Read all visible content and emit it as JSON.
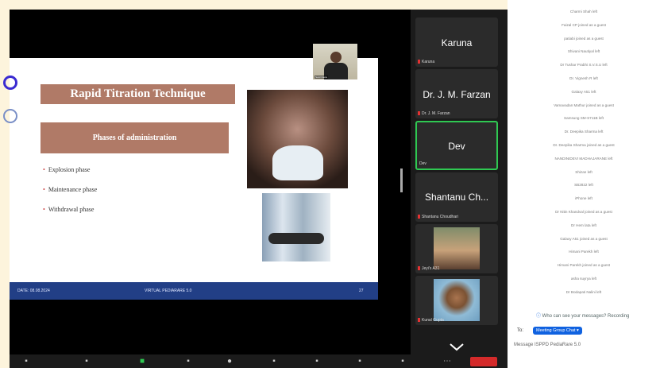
{
  "slide": {
    "title": "Rapid Titration Technique",
    "subtitle": "Phases of administration",
    "bullets": [
      "Explosion phase",
      "Maintenance phase",
      "Withdrawal phase"
    ],
    "footer_date": "DATE: 08.08.2024",
    "footer_event": "VIRTUAL PEDIARARE 5.0",
    "footer_page": "27"
  },
  "speaker_pip": {
    "name": "Sunil Rana"
  },
  "tiles": [
    {
      "big": "Karuna",
      "tag": "Karuna"
    },
    {
      "big": "Dr. J. M. Farzan",
      "tag": "Dr. J. M. Farzan"
    },
    {
      "big": "Dev",
      "tag": "Dev",
      "active": true
    },
    {
      "big": "Shantanu Ch...",
      "tag": "Shantanu Choudhari"
    },
    {
      "big": "",
      "tag": "Jeyi's A31"
    },
    {
      "big": "",
      "tag": "Kunal Gupta"
    }
  ],
  "chat": {
    "messages": [
      "Charmi Shah left",
      "Faizal CP joined as a guest",
      "patiabi joined as a guest",
      "Shivani Nautiyal left",
      "Dr Tushar Prabhi S.V.S.U left",
      "Dr. Vignesh R left",
      "Galaxy A51 left",
      "Vamavadan Mathur joined as a guest",
      "Samsung SM-S711B left",
      "Dr. Deepika Sharma left",
      "Dr. Deepika Sharma joined as a guest",
      "NANDINIDEVI MADHAJARANE left",
      "Shizan left",
      "SB2822 left",
      "iPhone left",
      "Dr Nitin Khandval joined as a guest",
      "Dr Hem lata left",
      "Galaxy A51 joined as a guest",
      "Himani Parekh left",
      "Himani Parekh joined as a guest",
      "asha suyrya left",
      "Dr Bodapati Nalini left"
    ],
    "who_can_see": "Who can see your messages? Recording",
    "to_label": "To:",
    "to_target": "Meeting Group Chat",
    "input_placeholder": "Message ISPPD PediaRare 5.0"
  },
  "colors": {
    "slide_title_bg": "#b07a67",
    "footer_bg": "#223f86",
    "active_tile_border": "#2fc852",
    "chat_pill": "#1062e0",
    "page_bg": "#fdf4dc"
  }
}
